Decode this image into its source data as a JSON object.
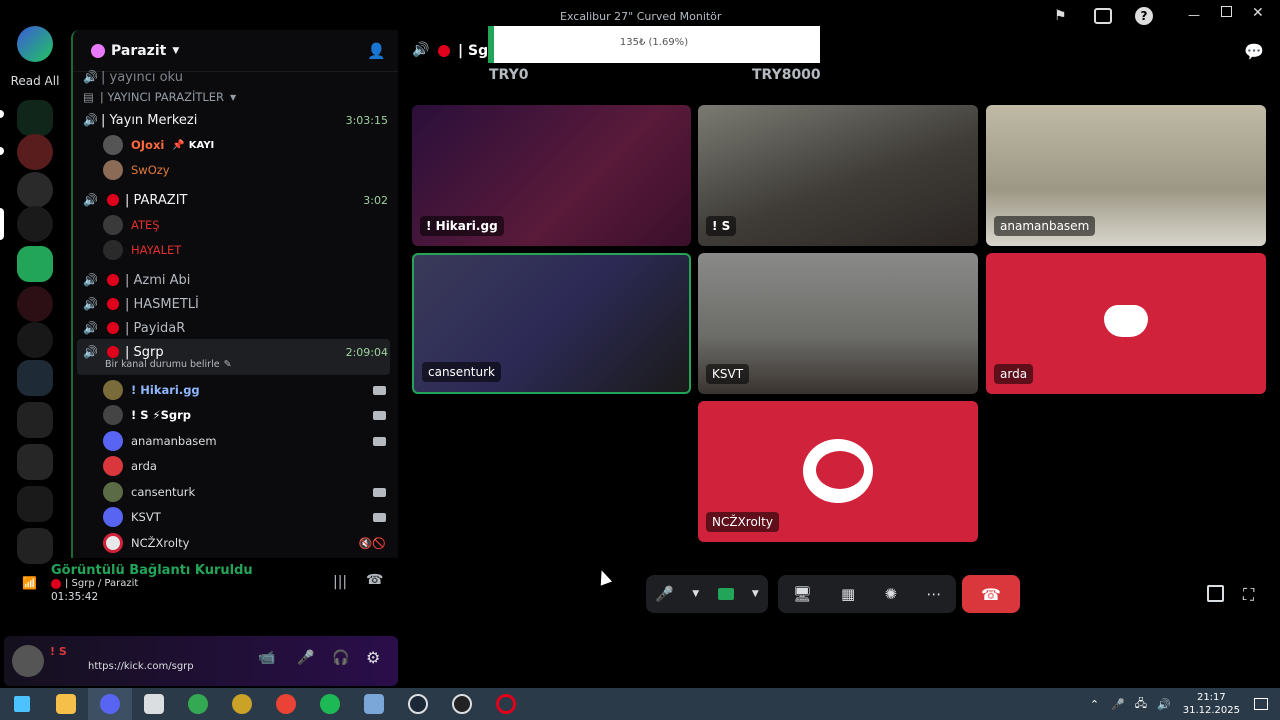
{
  "window": {
    "title": "Excalibur 27\" Curved Monitör",
    "overlay_title": "Parazit"
  },
  "rail": {
    "read_all": "Read All"
  },
  "server": {
    "name": "Parazit"
  },
  "sidebar": {
    "partial_top": "| yayıncı oku",
    "category": "| YAYINCI PARAZİTLER",
    "channels": [
      {
        "label": "| Yayın Merkezi",
        "time": "3:03:15",
        "users": [
          {
            "name": "OJoxi",
            "color": "#ff6a3d"
          },
          {
            "name": "KAYI",
            "color": "#ffffff"
          },
          {
            "name": "SwOzy",
            "color": "#e07a3c"
          }
        ]
      },
      {
        "label": "| PARAZIT",
        "time": "3:02",
        "users": [
          {
            "name": "ATEŞ",
            "color": "#e03030"
          },
          {
            "name": "HAYALET",
            "color": "#e03030"
          }
        ]
      },
      {
        "label": "| Azmi Abi"
      },
      {
        "label": "| HASMETLİ"
      },
      {
        "label": "| PayidaR"
      },
      {
        "label": "| Sgrp",
        "time": "2:09:04",
        "status": "Bir kanal durumu belirle"
      }
    ],
    "sgrp_users": [
      {
        "name": "! Hikari.gg",
        "color": "#8fb7ff",
        "cam": true
      },
      {
        "name": "! S  ⚡Sgrp",
        "color": "#ffffff",
        "cam": true
      },
      {
        "name": "anamanbasem",
        "color": "#b5bac1",
        "cam": true
      },
      {
        "name": "arda",
        "color": "#b5bac1",
        "cam": false
      },
      {
        "name": "cansenturk",
        "color": "#b5bac1",
        "cam": true
      },
      {
        "name": "KSVT",
        "color": "#b5bac1",
        "cam": true
      },
      {
        "name": "NCŽXrolty",
        "color": "#b5bac1",
        "cam": false
      }
    ]
  },
  "voice": {
    "status": "Görüntülü Bağlantı Kuruldu",
    "channel": "| Sgrp / Parazit",
    "elapsed": "01:35:42"
  },
  "user": {
    "name": "! S",
    "activity": "https://kick.com/sgrp"
  },
  "stage": {
    "channel": "| Sgr",
    "donation": {
      "label": "135₺ (1.69%)",
      "progress": 0.0169,
      "min": "TRY0",
      "max": "TRY8000"
    },
    "tiles": [
      {
        "name": "! Hikari.gg"
      },
      {
        "name": "! S"
      },
      {
        "name": "anamanbasem"
      },
      {
        "name": "cansenturk",
        "speaking": true
      },
      {
        "name": "KSVT"
      },
      {
        "name": "arda",
        "discord": true
      },
      {
        "name": "NCŽXrolty",
        "avatar": true
      }
    ]
  },
  "taskbar": {
    "time": "21:17",
    "date": "31.12.2025"
  },
  "colors": {
    "accent_green": "#23a559",
    "red": "#da373c",
    "discord_red": "#d0233b"
  }
}
